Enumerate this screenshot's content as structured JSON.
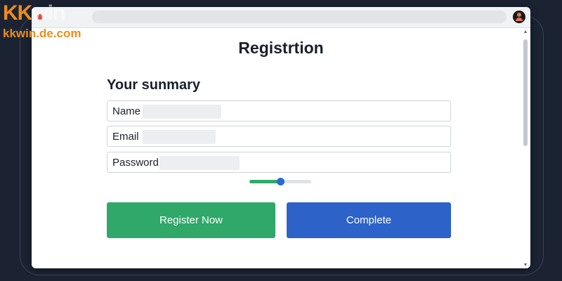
{
  "watermark": {
    "logo_text": "KKwin",
    "site": "kkwin.de.com"
  },
  "page": {
    "title": "Registrtion",
    "summary_heading": "Your sunmary"
  },
  "fields": [
    {
      "label": "Name"
    },
    {
      "label": "Email"
    },
    {
      "label": "Password"
    }
  ],
  "progress": {
    "value": 0.5
  },
  "buttons": {
    "register_label": "Register Now",
    "complete_label": "Complete"
  },
  "colors": {
    "register_button": "#2fa86a",
    "complete_button": "#2d63c8",
    "progress_fill": "#2faa6a",
    "progress_knob": "#2d69d6",
    "logo_orange": "#f08c1a"
  },
  "icons": {
    "account": "account-icon",
    "record": "record-dot-icon",
    "scroll_up": "scroll-up-arrow-icon",
    "scroll_down": "scroll-down-arrow-icon"
  }
}
